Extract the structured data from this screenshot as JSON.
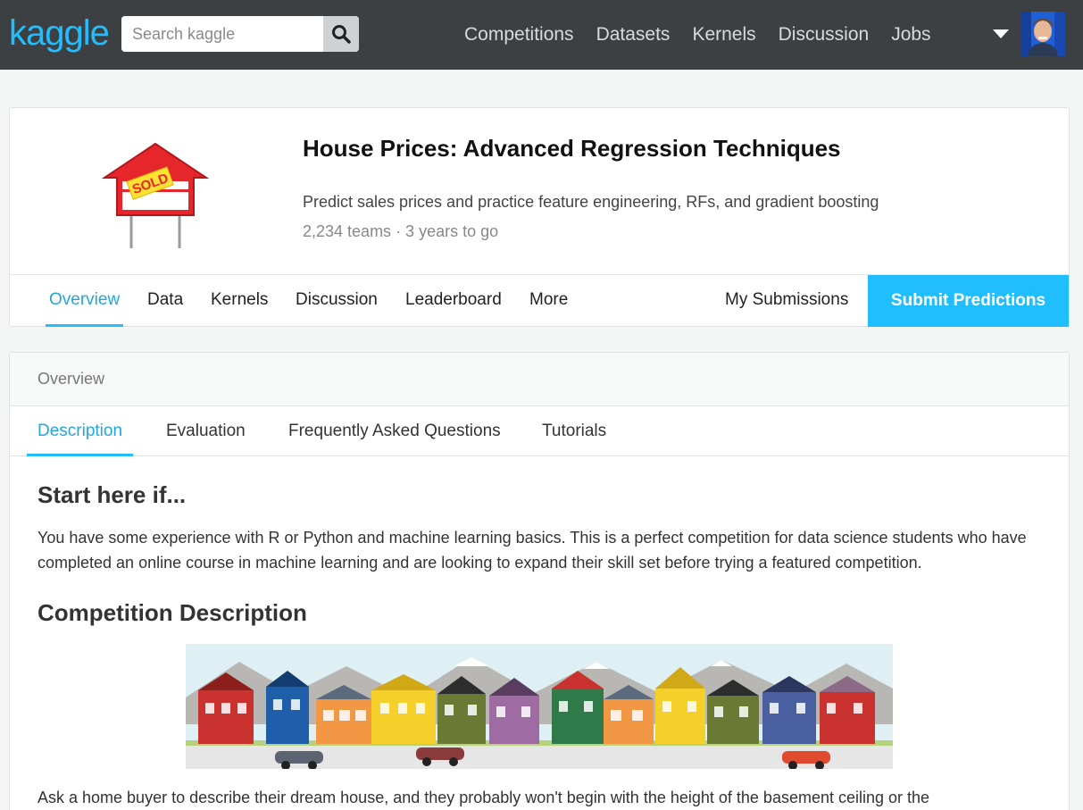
{
  "nav": {
    "logo": "kaggle",
    "search_placeholder": "Search kaggle",
    "links": [
      "Competitions",
      "Datasets",
      "Kernels",
      "Discussion",
      "Jobs"
    ]
  },
  "competition": {
    "title": "House Prices: Advanced Regression Techniques",
    "subtitle": "Predict sales prices and practice feature engineering, RFs, and gradient boosting",
    "meta": "2,234 teams · 3 years to go",
    "logo_sign_text": "SOLD",
    "tabs": [
      "Overview",
      "Data",
      "Kernels",
      "Discussion",
      "Leaderboard",
      "More"
    ],
    "my_submissions": "My Submissions",
    "submit_label": "Submit Predictions"
  },
  "overview": {
    "header": "Overview",
    "tabs": [
      "Description",
      "Evaluation",
      "Frequently Asked Questions",
      "Tutorials"
    ],
    "heading1": "Start here if...",
    "para1": "You have some experience with R or Python and machine learning basics. This is a perfect competition for data science students who have completed an online course in machine learning and are looking to expand their skill set before trying a featured competition.",
    "heading2": "Competition Description",
    "para2": "Ask a home buyer to describe their dream house, and they probably won't begin with the height of the basement ceiling or the"
  },
  "colors": {
    "accent": "#20beff",
    "topbar": "#3d4043"
  }
}
